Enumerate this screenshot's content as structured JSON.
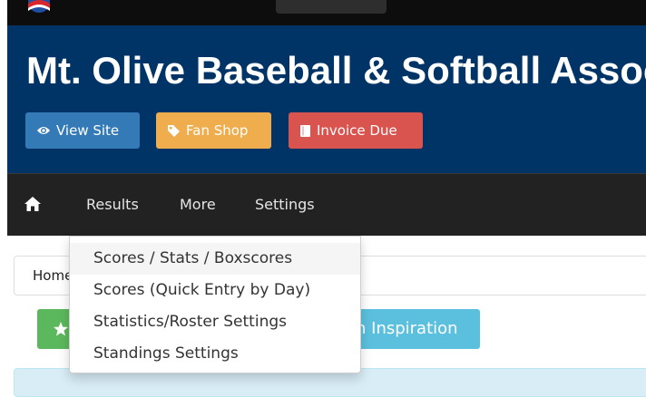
{
  "banner": {
    "title": "Mt. Olive Baseball & Softball Association",
    "buttons": {
      "view_site": "View Site",
      "fan_shop": "Fan Shop",
      "invoice_due": "Invoice Due"
    }
  },
  "navbar": {
    "items": [
      "Results",
      "More",
      "Settings"
    ]
  },
  "breadcrumb": {
    "home": "Home"
  },
  "actions": {
    "inspiration_label": "n Inspiration"
  },
  "dropdown": {
    "items": [
      "Scores / Stats / Boxscores",
      "Scores (Quick Entry by Day)",
      "Statistics/Roster Settings",
      "Standings Settings"
    ],
    "highlighted_index": 0
  },
  "icons": {
    "view_site": "eye-icon",
    "fan_shop": "tag-icon",
    "invoice_due": "file-icon",
    "home": "home-icon",
    "green_button": "star-icon"
  },
  "colors": {
    "banner": "#003366",
    "navbar": "#222222",
    "view_site": "#337ab7",
    "fan_shop": "#f0ad4e",
    "invoice_due": "#d9534f",
    "green": "#5cb85c",
    "teal": "#5bc0de"
  }
}
